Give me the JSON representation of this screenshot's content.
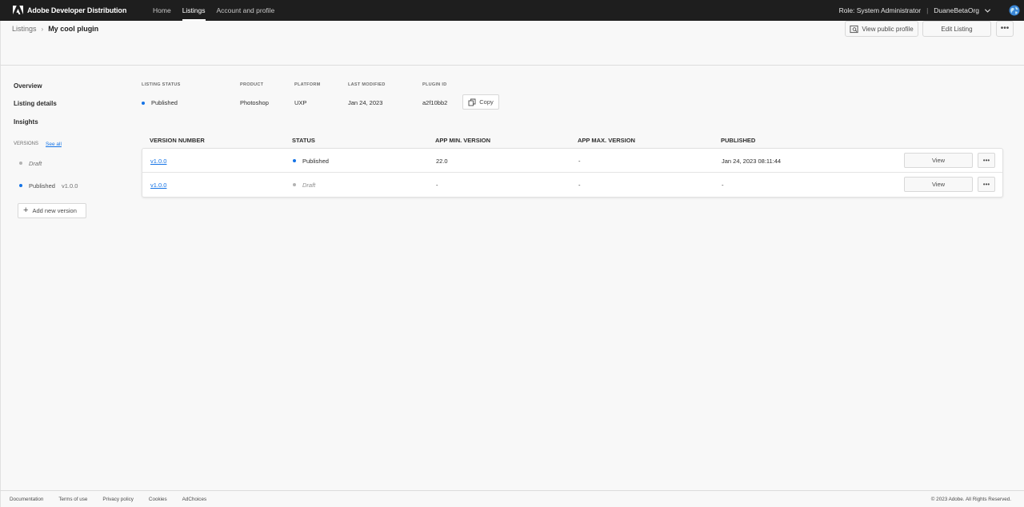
{
  "topnav": {
    "brand": "Adobe Developer Distribution",
    "items": [
      {
        "label": "Home",
        "active": false
      },
      {
        "label": "Listings",
        "active": true
      },
      {
        "label": "Account and profile",
        "active": false
      }
    ],
    "role": "Role: System Administrator",
    "separator": "|",
    "org": "DuaneBetaOrg"
  },
  "header": {
    "breadcrumb_parent": "Listings",
    "breadcrumb_separator": "›",
    "title": "My cool plugin",
    "view_public_profile": "View public profile",
    "edit_listing": "Edit Listing",
    "more": "•••"
  },
  "sidebar": {
    "links": [
      "Overview",
      "Listing details",
      "Insights"
    ],
    "versions_label": "VERSIONS",
    "see_all": "See all",
    "draft_label": "Draft",
    "published_label": "Published",
    "published_version": "v1.0.0",
    "add_new_version": "Add new version"
  },
  "summary": {
    "listing_status_label": "LISTING STATUS",
    "listing_status": "Published",
    "product_label": "PRODUCT",
    "product": "Photoshop",
    "platform_label": "PLATFORM",
    "platform": "UXP",
    "last_modified_label": "LAST MODIFIED",
    "last_modified": "Jan 24, 2023",
    "plugin_id_label": "PLUGIN ID",
    "plugin_id": "a2f10bb2",
    "copy": "Copy"
  },
  "versions_table": {
    "columns": [
      "VERSION NUMBER",
      "STATUS",
      "APP MIN. VERSION",
      "APP MAX. VERSION",
      "PUBLISHED"
    ],
    "rows": [
      {
        "version": "v1.0.0",
        "status": "Published",
        "min": "22.0",
        "max": "-",
        "published": "Jan 24, 2023 08:11:44",
        "view": "View",
        "more": "•••"
      },
      {
        "version": "v1.0.0",
        "status": "Draft",
        "min": "-",
        "max": "-",
        "published": "-",
        "view": "View",
        "more": "•••"
      }
    ]
  },
  "footer": {
    "links": [
      "Documentation",
      "Terms of use",
      "Privacy policy",
      "Cookies",
      "AdChoices"
    ],
    "copyright": "© 2023 Adobe. All Rights Reserved."
  },
  "colors": {
    "topbar": "#1e1e1e",
    "accent": "#1473e6",
    "background": "#f8f8f8"
  },
  "icons": [
    "adobe-logo-icon",
    "chevron-down-icon",
    "globe-icon",
    "profile-icon",
    "copy-icon",
    "plus-icon",
    "more-icon"
  ]
}
